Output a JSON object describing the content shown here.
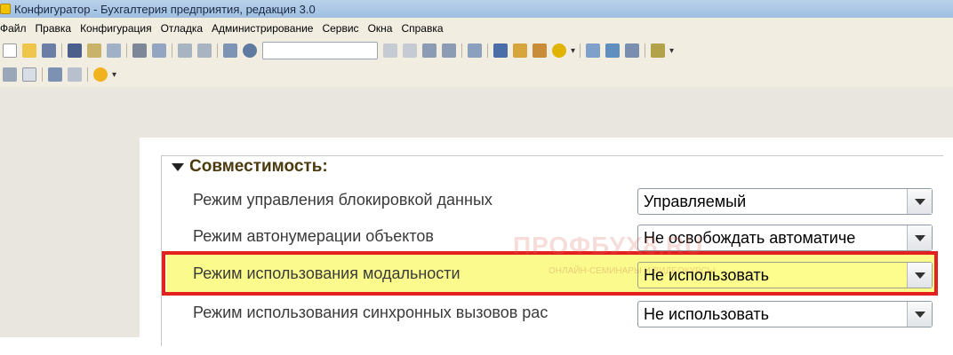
{
  "window": {
    "title": "Конфигуратор - Бухгалтерия предприятия, редакция 3.0"
  },
  "menu": {
    "items": [
      "Файл",
      "Правка",
      "Конфигурация",
      "Отладка",
      "Администрирование",
      "Сервис",
      "Окна",
      "Справка"
    ]
  },
  "toolbar": {
    "icons_row1": [
      "new-document-icon",
      "open-icon",
      "save-icon",
      "cut-icon",
      "copy-icon",
      "paste-icon",
      "print-icon",
      "print-preview-icon",
      "undo-icon",
      "redo-icon",
      "find-icon",
      "search-icon",
      "search-field",
      "clear-search-icon",
      "find-next-icon",
      "find-previous-icon",
      "window-icon",
      "debug-icon",
      "syntax-assistant-icon",
      "template-icon",
      "info-icon",
      "compare-icon",
      "update-icon",
      "database-icon",
      "module-icon"
    ],
    "icons_row2": [
      "grid-icon",
      "calc-icon",
      "db-config-icon",
      "table-icon",
      "run-icon"
    ]
  },
  "properties": {
    "group_title": "Совместимость:",
    "rows": [
      {
        "label": "Режим управления блокировкой данных",
        "value": "Управляемый"
      },
      {
        "label": "Режим автонумерации объектов",
        "value": "Не освобождать автоматиче"
      },
      {
        "label": "Режим использования модальности",
        "value": "Не использовать"
      },
      {
        "label": "Режим использования синхронных вызовов рас",
        "value": "Не использовать"
      }
    ]
  },
  "watermark": {
    "text": "ПРОФБУХ8.RU",
    "sub": "ОНЛАЙН-СЕМИНАРЫ И ВИДЕОКУРСЫ"
  },
  "colors": {
    "highlight": "#fbfb8d",
    "frame": "#e32020"
  }
}
